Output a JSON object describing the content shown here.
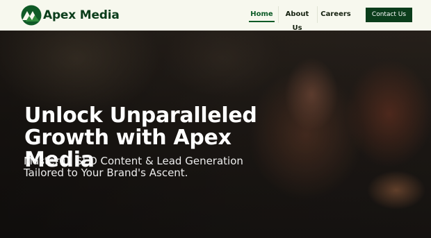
{
  "brand": {
    "name": "Apex Media",
    "logo_icon": "mountain-logo-icon",
    "primary_color": "#0b3d1b"
  },
  "nav": {
    "items": [
      {
        "label": "Home",
        "active": true
      },
      {
        "label": "About Us",
        "active": false
      },
      {
        "label": "Careers",
        "active": false
      }
    ],
    "contact_label": "Contact Us"
  },
  "hero": {
    "title": "Unlock Unparalleled Growth with Apex Media",
    "subtitle": "Masterful SEO Content & Lead Generation Tailored to Your Brand's Ascent."
  }
}
